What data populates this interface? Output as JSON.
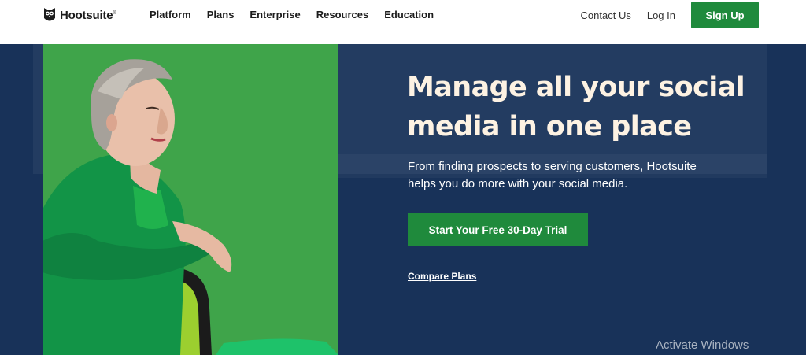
{
  "header": {
    "brand": "Hootsuite",
    "brand_mark": "®",
    "nav": [
      {
        "label": "Platform"
      },
      {
        "label": "Plans"
      },
      {
        "label": "Enterprise"
      },
      {
        "label": "Resources"
      },
      {
        "label": "Education"
      }
    ],
    "contact_label": "Contact Us",
    "login_label": "Log In",
    "signup_label": "Sign Up"
  },
  "hero": {
    "headline": "Manage all your social media in one place",
    "subtext": "From finding prospects to serving customers, Hootsuite helps you do more with your social media.",
    "cta_label": "Start Your Free 30-Day Trial",
    "compare_label": "Compare Plans"
  },
  "system": {
    "watermark": "Activate Windows"
  },
  "colors": {
    "hero_bg": "#183259",
    "primary_green": "#1f8a3c",
    "photo_green": "#3fa44a",
    "headline": "#fdf2e3"
  },
  "icons": {
    "logo": "owl-logo-icon"
  }
}
